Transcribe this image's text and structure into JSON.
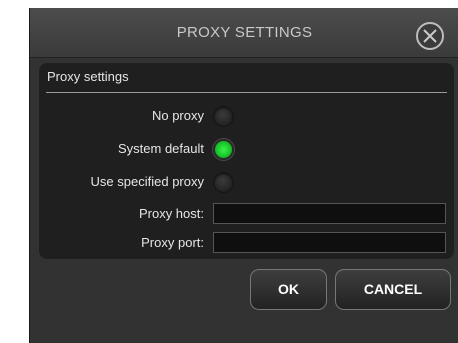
{
  "dialog": {
    "title": "PROXY SETTINGS",
    "close_icon": "close-circle-icon"
  },
  "proxy_group": {
    "title": "Proxy settings",
    "options": [
      {
        "label": "No proxy",
        "selected": false
      },
      {
        "label": "System default",
        "selected": true
      },
      {
        "label": "Use specified proxy",
        "selected": false
      }
    ],
    "host_label": "Proxy host:",
    "host_value": "",
    "port_label": "Proxy port:",
    "port_value": ""
  },
  "buttons": {
    "ok_label": "OK",
    "cancel_label": "CANCEL"
  },
  "colors": {
    "selected_radio": "#19c82b",
    "dialog_background": "#323232",
    "group_background": "#1f1f1f"
  }
}
